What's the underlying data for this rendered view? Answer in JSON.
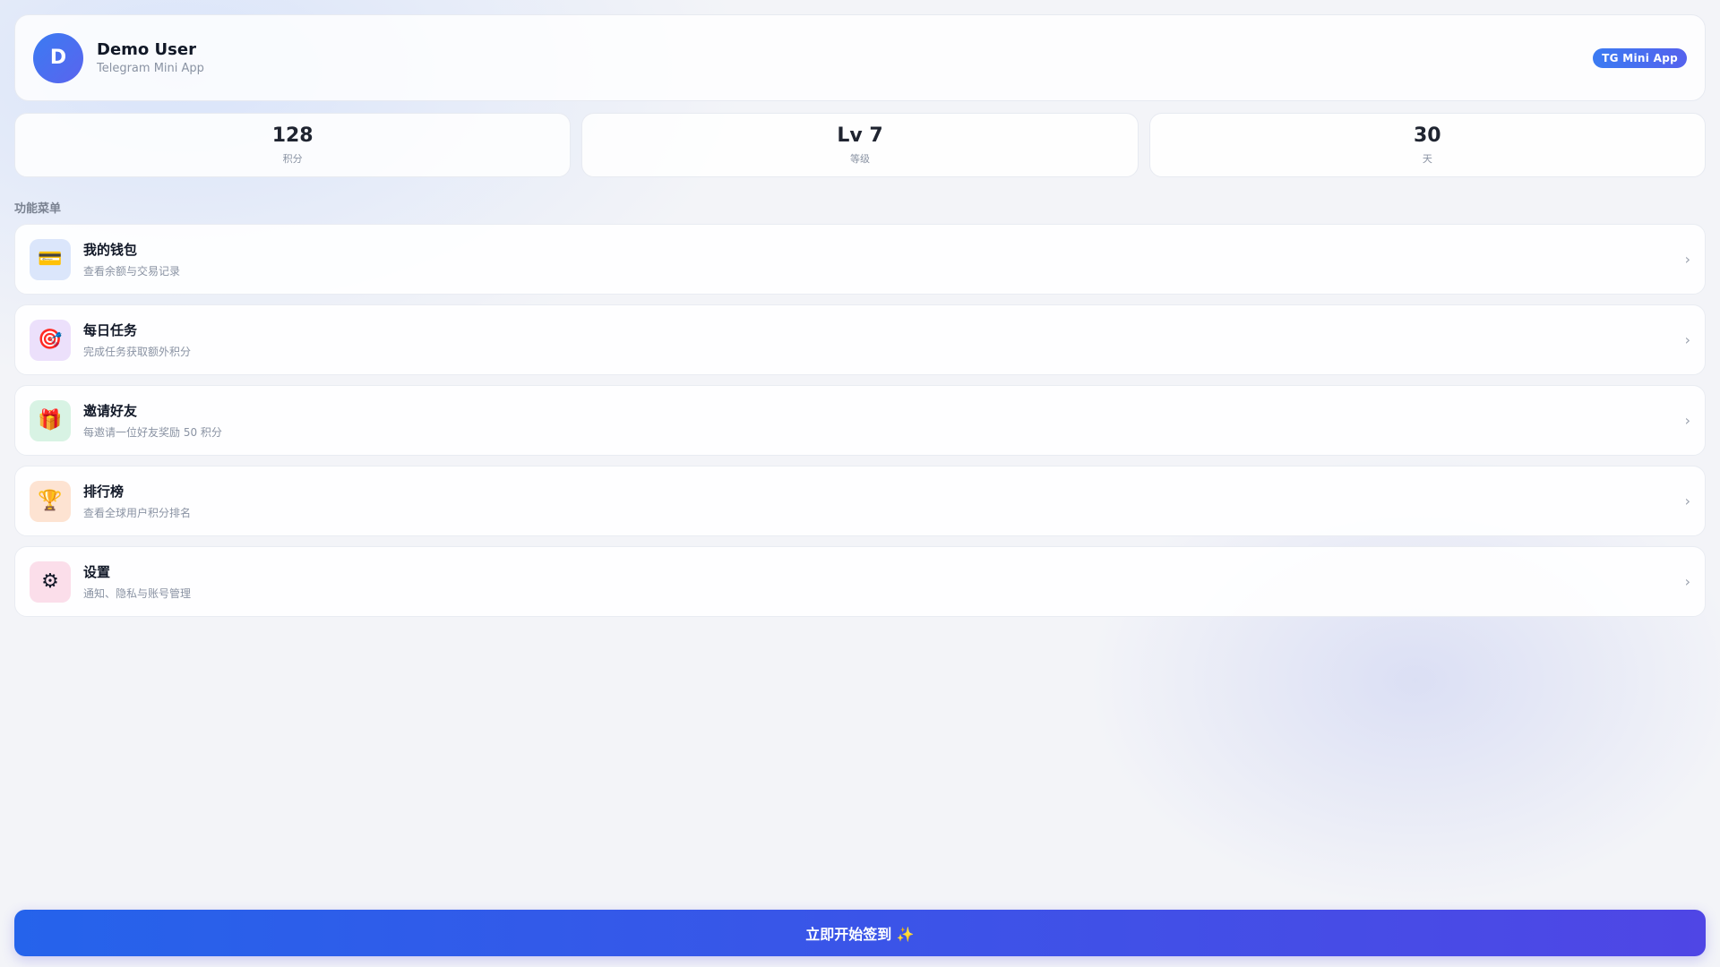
{
  "profile": {
    "avatar_letter": "D",
    "name": "Demo User",
    "subtitle": "Telegram Mini App",
    "badge": "TG Mini App"
  },
  "stats": [
    {
      "value": "128",
      "label": "积分"
    },
    {
      "value": "Lv 7",
      "label": "等级"
    },
    {
      "value": "30",
      "label": "天"
    }
  ],
  "menu": {
    "section_title": "功能菜单",
    "items": [
      {
        "icon": "credit-card-icon",
        "glyph": "💳",
        "bg": "#dbe6fb",
        "title": "我的钱包",
        "subtitle": "查看余额与交易记录"
      },
      {
        "icon": "target-icon",
        "glyph": "🎯",
        "bg": "#ece0fb",
        "title": "每日任务",
        "subtitle": "完成任务获取额外积分"
      },
      {
        "icon": "gift-icon",
        "glyph": "🎁",
        "bg": "#d8f3e4",
        "title": "邀请好友",
        "subtitle": "每邀请一位好友奖励 50 积分"
      },
      {
        "icon": "trophy-icon",
        "glyph": "🏆",
        "bg": "#fde3d2",
        "title": "排行榜",
        "subtitle": "查看全球用户积分排名"
      },
      {
        "icon": "gear-icon",
        "glyph": "⚙",
        "bg": "#fbdeea",
        "title": "设置",
        "subtitle": "通知、隐私与账号管理"
      }
    ],
    "chevron": "›"
  },
  "cta": {
    "label": "立即开始签到 ✨"
  },
  "colors": {
    "accent": "#2563eb",
    "accent_end": "#4f46e5",
    "background": "#f3f4f8"
  }
}
